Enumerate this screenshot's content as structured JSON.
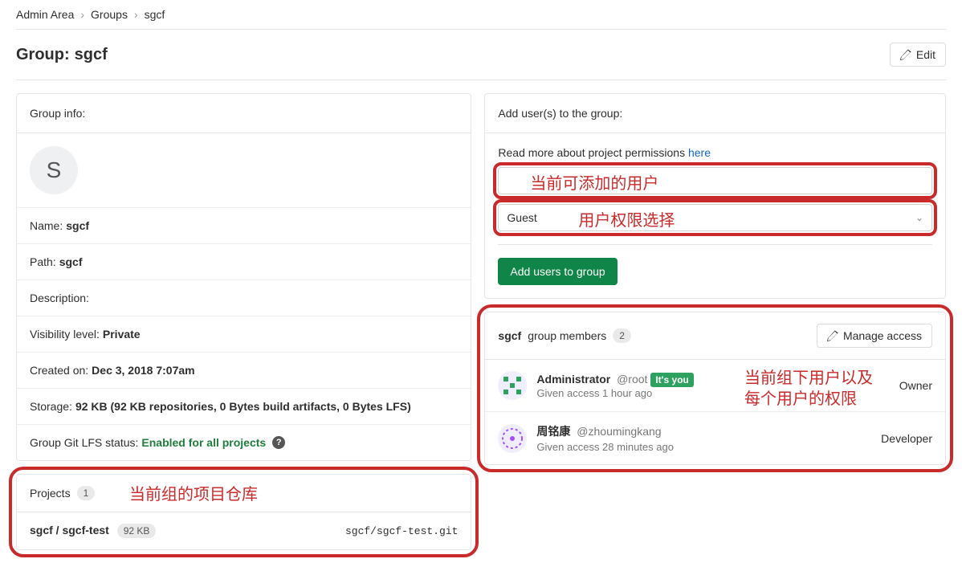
{
  "breadcrumb": {
    "admin": "Admin Area",
    "groups": "Groups",
    "current": "sgcf"
  },
  "page": {
    "title_prefix": "Group:",
    "group_name": "sgcf",
    "edit_label": "Edit"
  },
  "group_info": {
    "header": "Group info:",
    "avatar_letter": "S",
    "name_label": "Name:",
    "name_value": "sgcf",
    "path_label": "Path:",
    "path_value": "sgcf",
    "description_label": "Description:",
    "description_value": "",
    "visibility_label": "Visibility level:",
    "visibility_value": "Private",
    "created_label": "Created on:",
    "created_value": "Dec 3, 2018 7:07am",
    "storage_label": "Storage:",
    "storage_value": "92 KB (92 KB repositories, 0 Bytes build artifacts, 0 Bytes LFS)",
    "lfs_label": "Group Git LFS status:",
    "lfs_value": "Enabled for all projects"
  },
  "projects": {
    "header": "Projects",
    "count": "1",
    "items": [
      {
        "path": "sgcf / sgcf-test",
        "size": "92 KB",
        "git": "sgcf/sgcf-test.git"
      }
    ]
  },
  "add_users": {
    "header": "Add user(s) to the group:",
    "permissions_text": "Read more about project permissions ",
    "permissions_link": "here",
    "user_input_placeholder": "",
    "role_select": "Guest",
    "submit_label": "Add users to group"
  },
  "members": {
    "group_name": "sgcf",
    "title_suffix": "group members",
    "count": "2",
    "manage_label": "Manage access",
    "list": [
      {
        "name": "Administrator",
        "handle": "@root",
        "badge": "It's you",
        "given": "Given access 1 hour ago",
        "role": "Owner",
        "avatar_color": "#2da160"
      },
      {
        "name": "周铭康",
        "handle": "@zhoumingkang",
        "badge": "",
        "given": "Given access 28 minutes ago",
        "role": "Developer",
        "avatar_color": "#a64dff"
      }
    ]
  },
  "annotations": {
    "user_input": "当前可添加的用户",
    "role_select": "用户权限选择",
    "projects": "当前组的项目仓库",
    "members_line1": "当前组下用户以及",
    "members_line2": "每个用户的权限"
  }
}
